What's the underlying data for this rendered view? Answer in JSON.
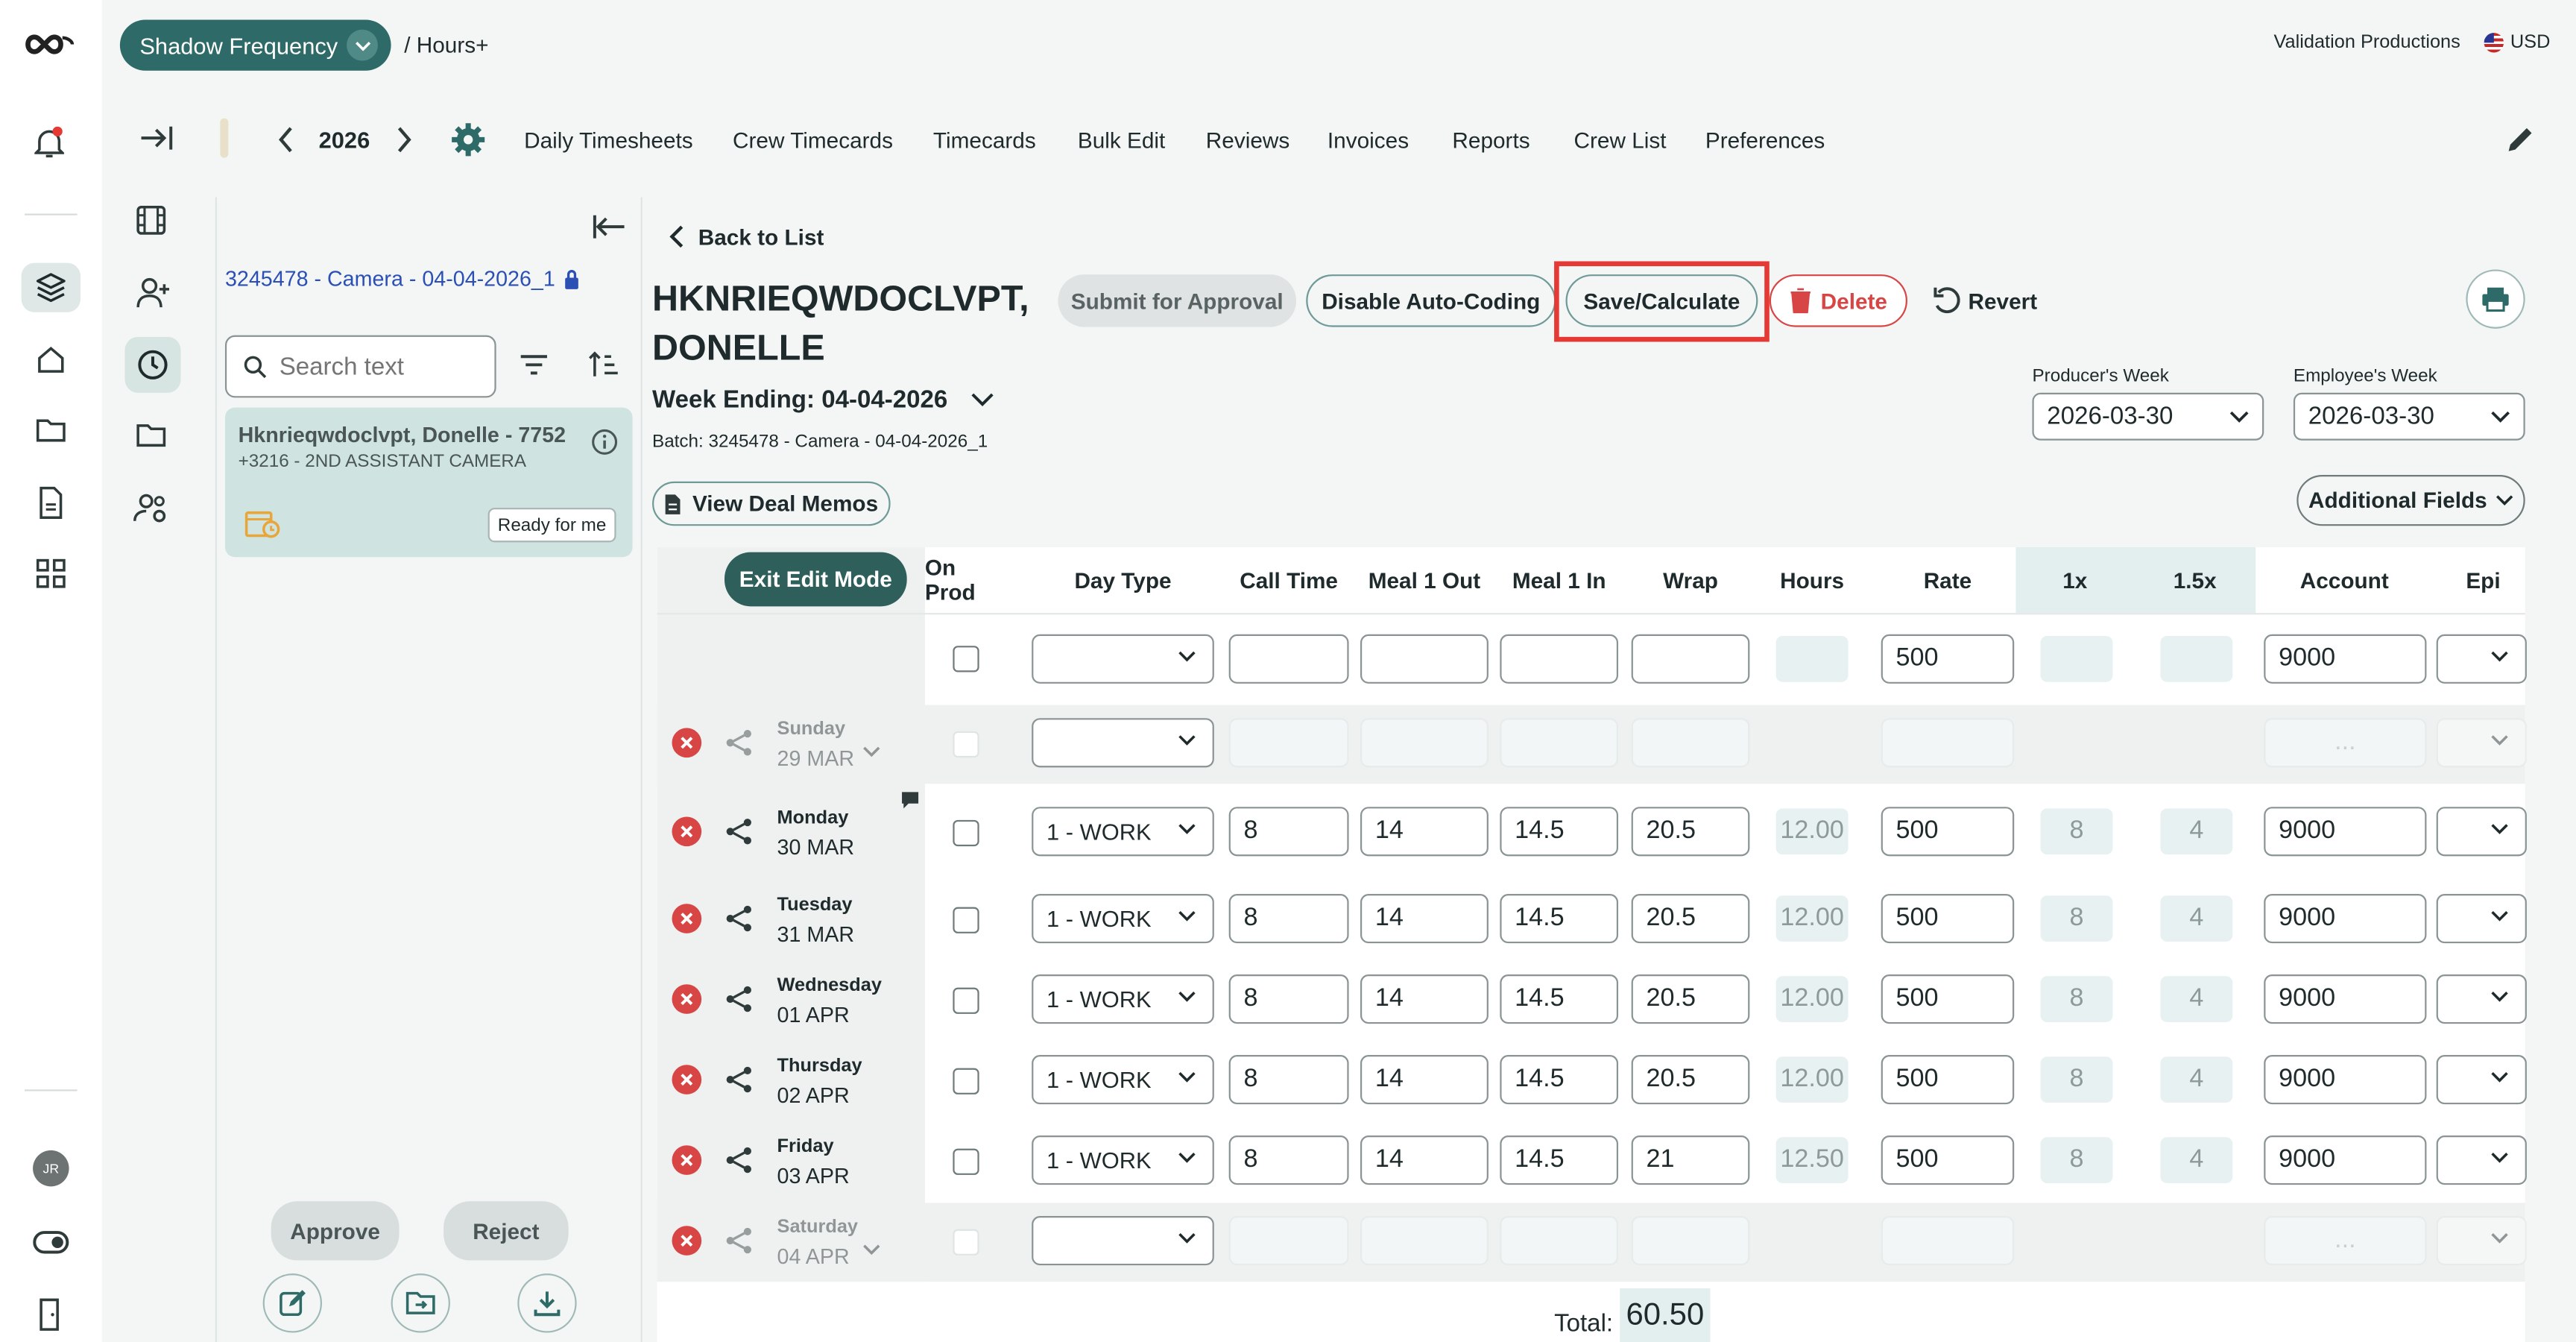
{
  "header": {
    "project": "Shadow Frequency",
    "breadcrumb": "/ Hours+",
    "company": "Validation Productions",
    "currency": "USD"
  },
  "nav": {
    "year": "2026",
    "items": [
      "Daily Timesheets",
      "Crew Timecards",
      "Timecards",
      "Bulk Edit",
      "Reviews",
      "Invoices",
      "Reports",
      "Crew List",
      "Preferences"
    ]
  },
  "rail": {
    "avatar_initials": "JR"
  },
  "list_panel": {
    "batch_title": "3245478 - Camera - 04-04-2026_1",
    "search_placeholder": "Search text",
    "card": {
      "name": "Hknrieqwdoclvpt, Donelle - 7752",
      "sub": "+3216 - 2ND ASSISTANT CAMERA",
      "badge": "Ready for me"
    },
    "approve": "Approve",
    "reject": "Reject"
  },
  "timecard": {
    "back": "Back to List",
    "name_line1": "HKNRIEQWDOCLVPT,",
    "name_line2": "DONELLE",
    "week_ending": "Week Ending: 04-04-2026",
    "batch": "Batch: 3245478 - Camera - 04-04-2026_1",
    "buttons": {
      "submit": "Submit for Approval",
      "disable_auto": "Disable Auto-Coding",
      "save": "Save/Calculate",
      "delete": "Delete",
      "revert": "Revert"
    },
    "producers_week_label": "Producer's Week",
    "producers_week": "2026-03-30",
    "employees_week_label": "Employee's Week",
    "employees_week": "2026-03-30",
    "view_deal_memos": "View Deal Memos",
    "additional_fields": "Additional Fields",
    "exit_edit": "Exit Edit Mode",
    "total_label": "Total:",
    "total_value": "60.50"
  },
  "grid": {
    "columns": [
      "On Prod",
      "Day Type",
      "Call Time",
      "Meal 1 Out",
      "Meal 1 In",
      "Wrap",
      "Hours",
      "Rate",
      "1x",
      "1.5x",
      "Account",
      "Epi"
    ],
    "default_row": {
      "rate": "500",
      "account": "9000"
    },
    "rows": [
      {
        "day": "Sunday",
        "date": "29 MAR",
        "active": false,
        "day_type": "",
        "call": "",
        "m1out": "",
        "m1in": "",
        "wrap": "",
        "hours": "",
        "rate": "",
        "x1": "",
        "x15": "",
        "account": "..."
      },
      {
        "day": "Monday",
        "date": "30 MAR",
        "active": true,
        "day_type": "1 - WORK",
        "call": "8",
        "m1out": "14",
        "m1in": "14.5",
        "wrap": "20.5",
        "hours": "12.00",
        "rate": "500",
        "x1": "8",
        "x15": "4",
        "account": "9000"
      },
      {
        "day": "Tuesday",
        "date": "31 MAR",
        "active": true,
        "day_type": "1 - WORK",
        "call": "8",
        "m1out": "14",
        "m1in": "14.5",
        "wrap": "20.5",
        "hours": "12.00",
        "rate": "500",
        "x1": "8",
        "x15": "4",
        "account": "9000"
      },
      {
        "day": "Wednesday",
        "date": "01 APR",
        "active": true,
        "day_type": "1 - WORK",
        "call": "8",
        "m1out": "14",
        "m1in": "14.5",
        "wrap": "20.5",
        "hours": "12.00",
        "rate": "500",
        "x1": "8",
        "x15": "4",
        "account": "9000"
      },
      {
        "day": "Thursday",
        "date": "02 APR",
        "active": true,
        "day_type": "1 - WORK",
        "call": "8",
        "m1out": "14",
        "m1in": "14.5",
        "wrap": "20.5",
        "hours": "12.00",
        "rate": "500",
        "x1": "8",
        "x15": "4",
        "account": "9000"
      },
      {
        "day": "Friday",
        "date": "03 APR",
        "active": true,
        "day_type": "1 - WORK",
        "call": "8",
        "m1out": "14",
        "m1in": "14.5",
        "wrap": "21",
        "hours": "12.50",
        "rate": "500",
        "x1": "8",
        "x15": "4",
        "account": "9000"
      },
      {
        "day": "Saturday",
        "date": "04 APR",
        "active": false,
        "day_type": "",
        "call": "",
        "m1out": "",
        "m1in": "",
        "wrap": "",
        "hours": "",
        "rate": "",
        "x1": "",
        "x15": "",
        "account": "..."
      }
    ]
  },
  "colors": {
    "accent": "#2e6a67",
    "danger": "#d84545",
    "highlight": "#e53935"
  }
}
